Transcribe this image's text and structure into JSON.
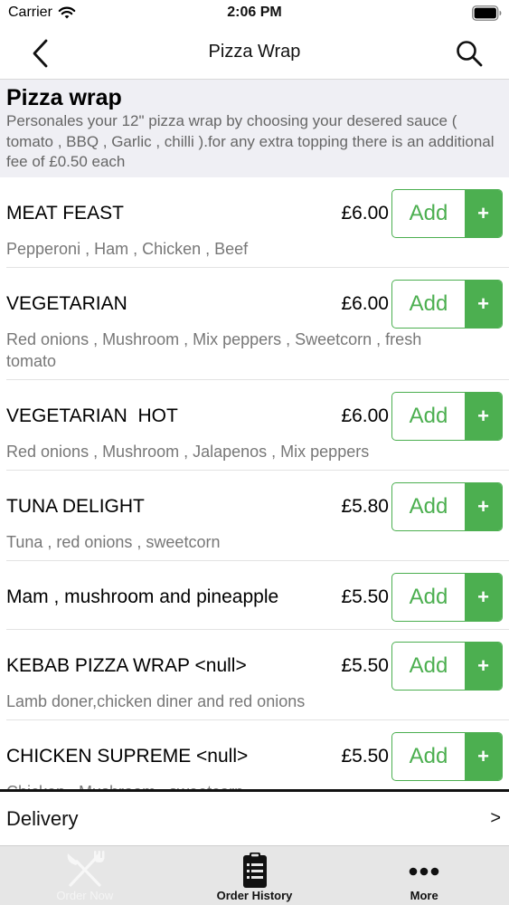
{
  "status_bar": {
    "carrier": "Carrier",
    "time": "2:06 PM"
  },
  "nav": {
    "title": "Pizza Wrap",
    "back_icon": "chevron-left-icon",
    "search_icon": "search-icon"
  },
  "category": {
    "title": "Pizza wrap",
    "description": "Personales your 12\" pizza wrap by choosing your desered sauce ( tomato , BBQ , Garlic , chilli ).for any extra topping there is an additional fee of £0.50 each"
  },
  "menu_items": [
    {
      "name": "MEAT FEAST",
      "price": "£6.00",
      "description": "Pepperoni , Ham , Chicken , Beef",
      "add_label": "Add",
      "plus_label": "+"
    },
    {
      "name": "VEGETARIAN",
      "price": "£6.00",
      "description": "Red onions , Mushroom , Mix peppers , Sweetcorn , fresh tomato",
      "add_label": "Add",
      "plus_label": "+"
    },
    {
      "name": "VEGETARIAN  HOT",
      "price": "£6.00",
      "description": "Red onions , Mushroom , Jalapenos , Mix peppers",
      "add_label": "Add",
      "plus_label": "+"
    },
    {
      "name": "TUNA DELIGHT",
      "price": "£5.80",
      "description": "Tuna , red onions , sweetcorn",
      "add_label": "Add",
      "plus_label": "+"
    },
    {
      "name": "Mam , mushroom and pineapple",
      "price": "£5.50",
      "description": "",
      "add_label": "Add",
      "plus_label": "+"
    },
    {
      "name": "KEBAB PIZZA WRAP <null>",
      "price": "£5.50",
      "description": "Lamb doner,chicken diner and red onions",
      "add_label": "Add",
      "plus_label": "+"
    },
    {
      "name": "CHICKEN SUPREME <null>",
      "price": "£5.50",
      "description": "Chicken , Mushroom , sweetcorn",
      "add_label": "Add",
      "plus_label": "+"
    }
  ],
  "delivery": {
    "label": "Delivery",
    "arrow": ">"
  },
  "tabs": [
    {
      "label": "Order Now",
      "icon": "fork-knife-icon",
      "active": false
    },
    {
      "label": "Order History",
      "icon": "clipboard-list-icon",
      "active": true
    },
    {
      "label": "More",
      "icon": "more-dots-icon",
      "active": true
    }
  ],
  "colors": {
    "accent_green": "#4caf50",
    "header_background": "#efeff4",
    "tab_bar_background": "#e6e6e6"
  }
}
